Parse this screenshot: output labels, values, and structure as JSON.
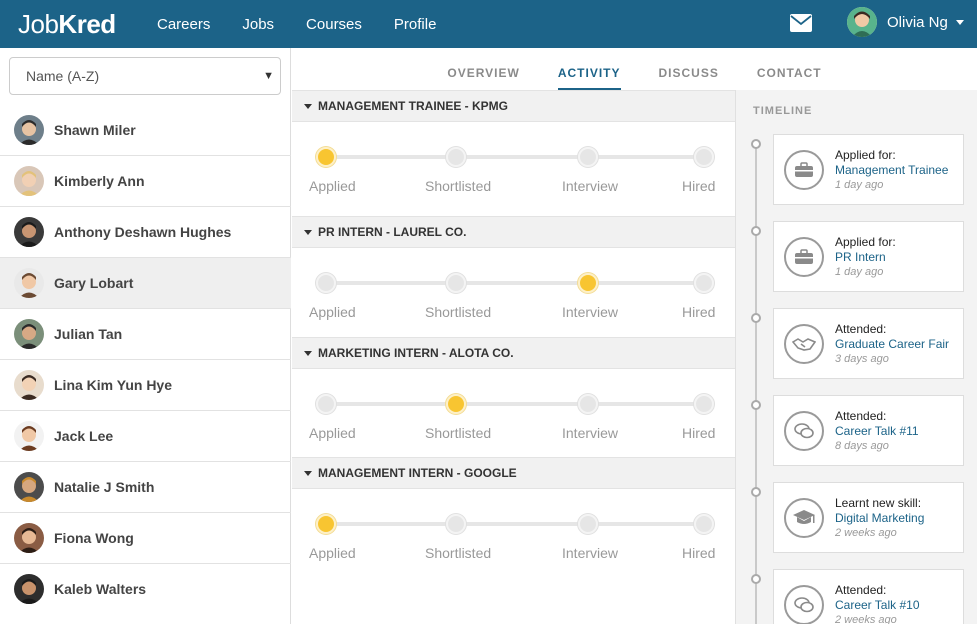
{
  "brand": {
    "logo_light": "Job",
    "logo_bold": "Kred"
  },
  "nav": {
    "items": [
      "Careers",
      "Jobs",
      "Courses",
      "Profile"
    ]
  },
  "header": {
    "user_name": "Olivia Ng"
  },
  "sidebar": {
    "sort_value": "Name (A-Z)",
    "people": [
      {
        "name": "Shawn Miler"
      },
      {
        "name": "Kimberly Ann"
      },
      {
        "name": "Anthony Deshawn Hughes"
      },
      {
        "name": "Gary Lobart",
        "selected": true
      },
      {
        "name": "Julian Tan"
      },
      {
        "name": "Lina Kim Yun Hye"
      },
      {
        "name": "Jack Lee"
      },
      {
        "name": "Natalie J Smith"
      },
      {
        "name": "Fiona Wong"
      },
      {
        "name": "Kaleb Walters"
      }
    ]
  },
  "tabs": [
    {
      "label": "OVERVIEW"
    },
    {
      "label": "ACTIVITY",
      "active": true
    },
    {
      "label": "DISCUSS"
    },
    {
      "label": "CONTACT"
    }
  ],
  "stages": [
    "Applied",
    "Shortlisted",
    "Interview",
    "Hired"
  ],
  "applications": [
    {
      "title": "MANAGEMENT TRAINEE - KPMG",
      "current_stage": "Applied"
    },
    {
      "title": "PR INTERN - LAUREL CO.",
      "current_stage": "Interview"
    },
    {
      "title": "MARKETING INTERN - ALOTA CO.",
      "current_stage": "Shortlisted"
    },
    {
      "title": "MANAGEMENT INTERN  - GOOGLE",
      "current_stage": "Applied"
    }
  ],
  "timeline": {
    "title": "TIMELINE",
    "events": [
      {
        "action": "Applied for:",
        "target": "Management Trainee",
        "time": "1 day ago",
        "icon": "briefcase-icon"
      },
      {
        "action": "Applied for:",
        "target": "PR Intern",
        "time": "1 day ago",
        "icon": "briefcase-icon"
      },
      {
        "action": "Attended:",
        "target": "Graduate Career Fair",
        "time": "3 days ago",
        "icon": "handshake-icon"
      },
      {
        "action": "Attended:",
        "target": "Career Talk #11",
        "time": "8 days ago",
        "icon": "chat-icon"
      },
      {
        "action": "Learnt new skill:",
        "target": "Digital Marketing",
        "time": "2 weeks ago",
        "icon": "graduation-cap-icon"
      },
      {
        "action": "Attended:",
        "target": "Career Talk #10",
        "time": "2 weeks ago",
        "icon": "chat-icon"
      }
    ]
  },
  "colors": {
    "primary": "#1c6388",
    "stage_active": "#f8c531",
    "stage_inactive": "#e6e6e6"
  }
}
